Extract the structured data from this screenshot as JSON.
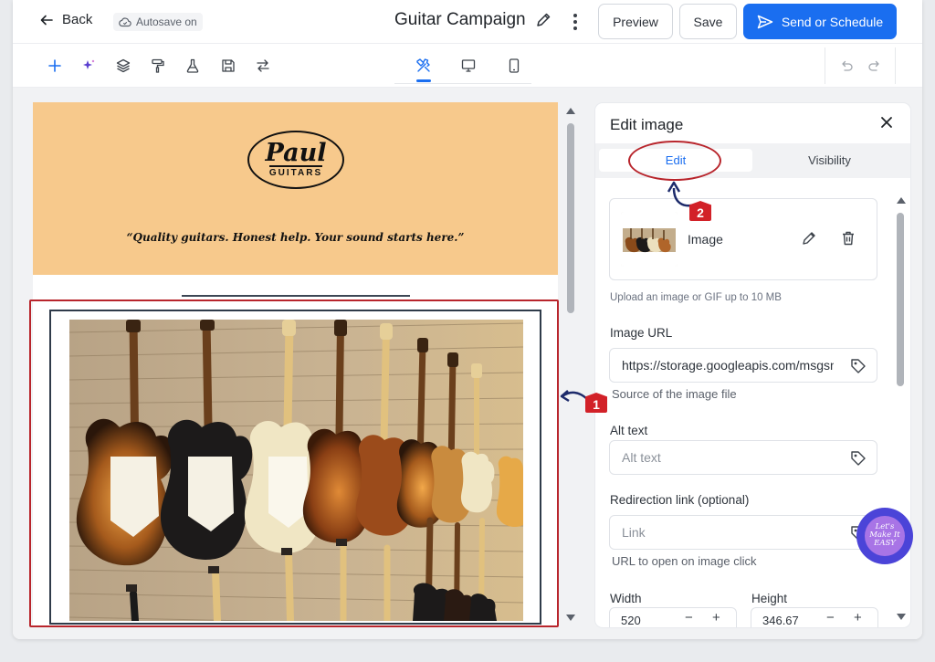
{
  "topbar": {
    "back_label": "Back",
    "autosave_label": "Autosave on",
    "campaign_title": "Guitar Campaign",
    "preview_label": "Preview",
    "save_label": "Save",
    "send_label": "Send or Schedule"
  },
  "toolbar": {
    "tools": [
      "plus-icon",
      "sparkle-icon",
      "layers-icon",
      "paint-roller-icon",
      "flask-icon",
      "floppy-disk-icon",
      "swap-arrows-icon"
    ],
    "device_tools": [
      "design-tools-icon",
      "desktop-icon",
      "mobile-icon"
    ],
    "active_device_tool": "design-tools-icon",
    "history": [
      "undo-icon",
      "redo-icon"
    ]
  },
  "email": {
    "logo_name": "Paul",
    "logo_sub": "GUITARS",
    "tagline": "“Quality guitars. Honest help. Your sound starts here.”",
    "header_color": "#f7c98c"
  },
  "panel": {
    "title": "Edit image",
    "tabs": [
      {
        "label": "Edit",
        "active": true
      },
      {
        "label": "Visibility",
        "active": false
      }
    ],
    "image_card": {
      "label": "Image"
    },
    "upload_hint": "Upload an image or GIF up to 10 MB",
    "image_url": {
      "label": "Image URL",
      "value": "https://storage.googleapis.com/msgsndr/",
      "helper": "Source of the image file"
    },
    "alt_text": {
      "label": "Alt text",
      "placeholder": "Alt text"
    },
    "redirect": {
      "label": "Redirection link (optional)",
      "placeholder": "Link",
      "helper": "URL to open on image click"
    },
    "width": {
      "label": "Width",
      "value": "520"
    },
    "height": {
      "label": "Height",
      "value": "346.67"
    }
  },
  "annotations": {
    "badge_1": "1",
    "badge_2": "2",
    "sticker_text": "Let's Make It EASY"
  },
  "colors": {
    "accent": "#1a6ef0",
    "annotation_red": "#b8252c"
  }
}
